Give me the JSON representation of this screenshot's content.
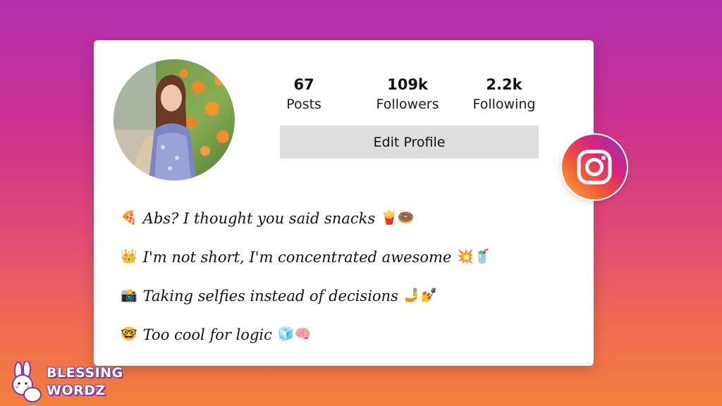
{
  "profile": {
    "avatar_alt": "profile-photo"
  },
  "stats": [
    {
      "value": "67",
      "label": "Posts"
    },
    {
      "value": "109k",
      "label": "Followers"
    },
    {
      "value": "2.2k",
      "label": "Following"
    }
  ],
  "edit_button": {
    "label": "Edit Profile"
  },
  "bio": [
    {
      "emoji_start": "🍕",
      "text": "Abs? I thought you said snacks",
      "emoji_end": "🍟🍩"
    },
    {
      "emoji_start": "👑",
      "text": "I'm not short, I'm concentrated awesome",
      "emoji_end": "💥🥤"
    },
    {
      "emoji_start": "📸",
      "text": "Taking selfies instead of decisions",
      "emoji_end": "🤳💅"
    },
    {
      "emoji_start": "🤓",
      "text": "Too cool for logic",
      "emoji_end": "🧊🧠"
    }
  ],
  "watermark": {
    "line1": "BLESSING",
    "line2": "WORDZ"
  },
  "colors": {
    "accent_gradient_top": "#b02fb0",
    "accent_gradient_bottom": "#f2803e",
    "button_bg": "#dedede"
  },
  "icons": {
    "brand": "instagram-icon",
    "watermark_mascot": "bunny-icon"
  }
}
